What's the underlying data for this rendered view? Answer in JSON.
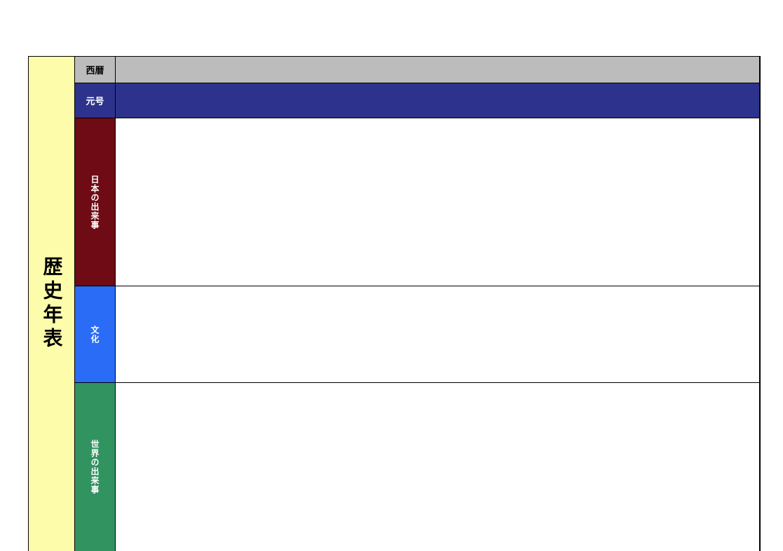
{
  "title": "歴史年表",
  "rows": {
    "year": {
      "label": "西暦"
    },
    "era": {
      "label": "元号"
    },
    "japan": {
      "label": "日本の出来事"
    },
    "culture": {
      "label": "文化"
    },
    "world": {
      "label": "世界の出来事"
    }
  }
}
